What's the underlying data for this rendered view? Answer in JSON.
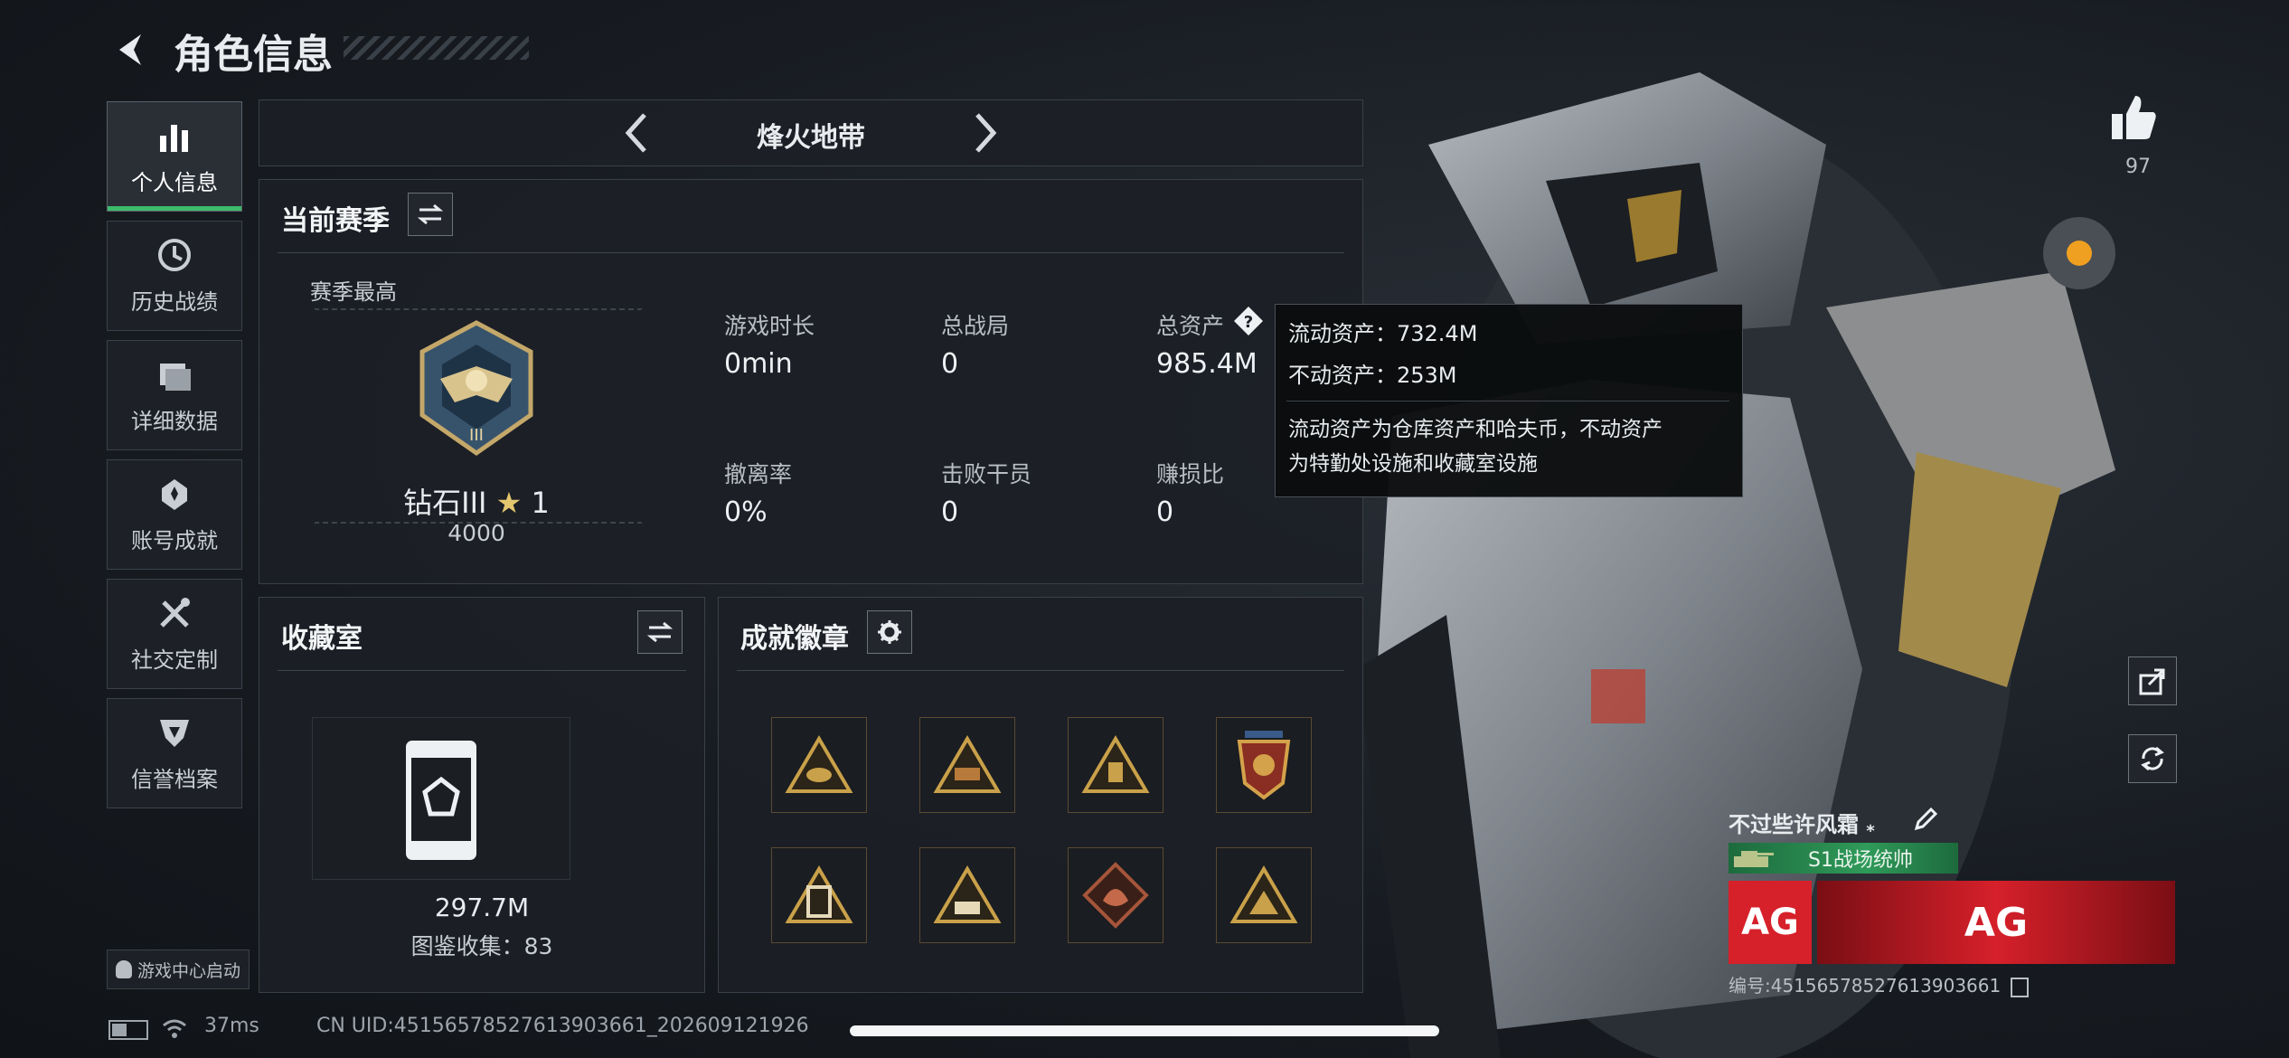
{
  "header": {
    "title": "角色信息"
  },
  "mode_selector": {
    "label": "烽火地带"
  },
  "nav": [
    {
      "label": "个人信息",
      "icon": "bar-chart-icon"
    },
    {
      "label": "历史战绩",
      "icon": "clock-icon"
    },
    {
      "label": "详细数据",
      "icon": "folder-icon"
    },
    {
      "label": "账号成就",
      "icon": "achievement-icon"
    },
    {
      "label": "社交定制",
      "icon": "tools-icon"
    },
    {
      "label": "信誉档案",
      "icon": "shield-icon"
    }
  ],
  "game_center": {
    "label": "游戏中心启动"
  },
  "season": {
    "title": "当前赛季",
    "best_label": "赛季最高",
    "rank_name": "钻石III",
    "rank_stars": "1",
    "rank_points": "4000",
    "stats": [
      {
        "label": "游戏时长",
        "value": "0min"
      },
      {
        "label": "总战局",
        "value": "0"
      },
      {
        "label": "总资产",
        "value": "985.4M"
      },
      {
        "label": "撤离率",
        "value": "0%"
      },
      {
        "label": "击败干员",
        "value": "0"
      },
      {
        "label": "赚损比",
        "value": "0"
      }
    ]
  },
  "tooltip": {
    "line1": "流动资产：732.4M",
    "line2": "不动资产：253M",
    "desc1": "流动资产为仓库资产和哈夫币，不动资产",
    "desc2": "为特勤处设施和收藏室设施"
  },
  "collection": {
    "title": "收藏室",
    "value": "297.7M",
    "count_text": "图鉴收集：83"
  },
  "badges": {
    "title": "成就徽章",
    "count": 8
  },
  "likes": {
    "count": "97"
  },
  "player": {
    "name": "不过些许风霜",
    "title": "S1战场统帅",
    "id_text": "编号:4515657852761390366​1"
  },
  "status_bar": {
    "ping": "37ms",
    "uid": "CN UID:4515657852761390366​1_202609121926"
  },
  "colors": {
    "accent_green": "#3dbb6b",
    "tooltip_bg": "#0c0e10",
    "ag_red": "#d6202a"
  }
}
